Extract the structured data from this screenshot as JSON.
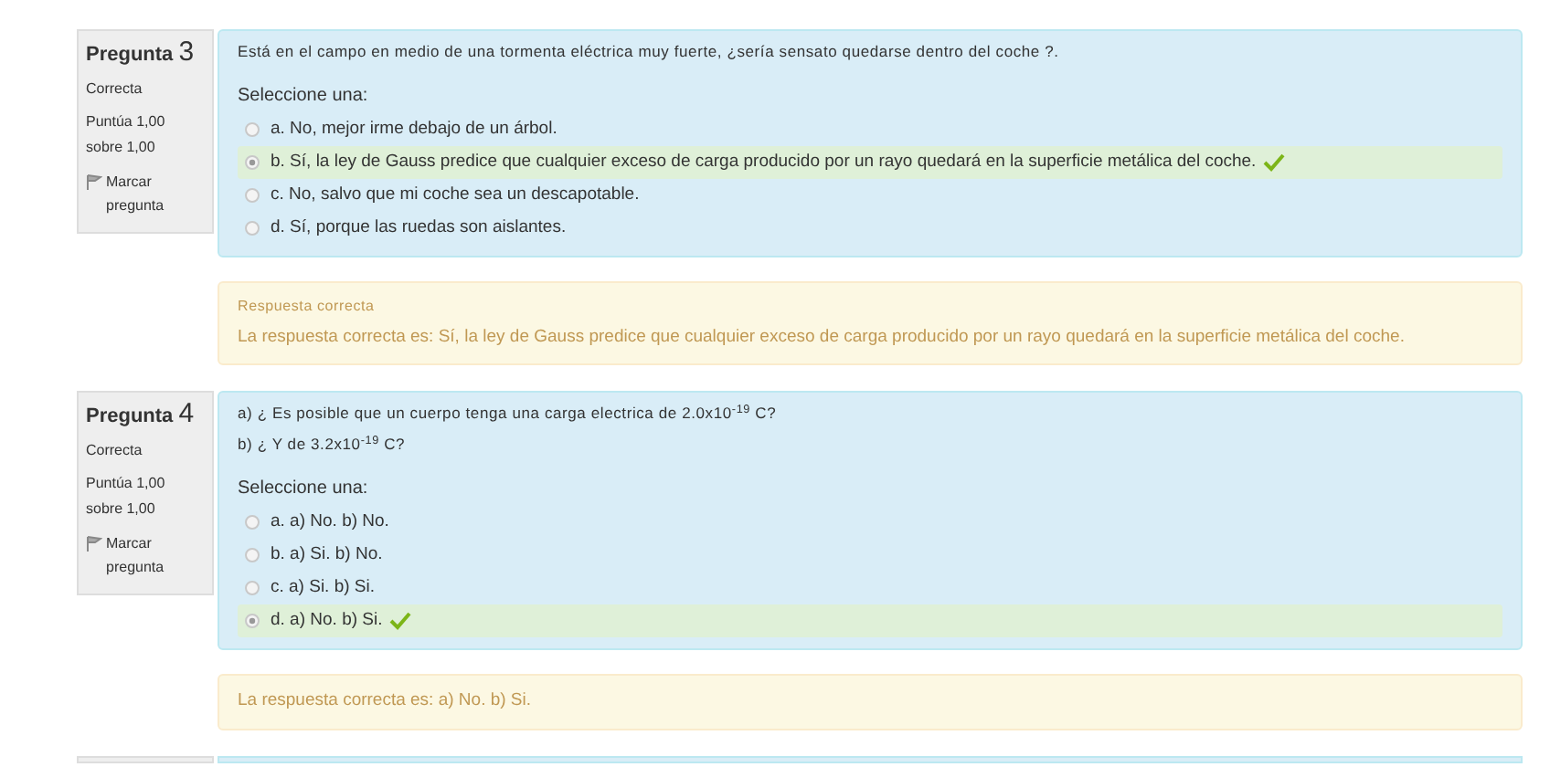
{
  "questions": [
    {
      "label": "Pregunta",
      "number": "3",
      "state": "Correcta",
      "score": [
        "Puntúa 1,00",
        "sobre 1,00"
      ],
      "flag": "Marcar pregunta",
      "question_lines": [
        "Está en el campo en medio de una tormenta eléctrica muy fuerte, ¿sería sensato quedarse dentro del coche ?."
      ],
      "prompt": "Seleccione una:",
      "options": [
        {
          "text": "a. No, mejor irme debajo de un árbol.",
          "selected": false,
          "correct": false
        },
        {
          "text": "b. Sí, la ley de Gauss predice que cualquier exceso de carga producido por un rayo quedará en la superficie metálica del coche.",
          "selected": true,
          "correct": true
        },
        {
          "text": "c. No, salvo que mi coche sea un descapotable.",
          "selected": false,
          "correct": false
        },
        {
          "text": "d. Sí, porque las ruedas son aislantes.",
          "selected": false,
          "correct": false
        }
      ],
      "feedback": {
        "title": "Respuesta correcta",
        "text": "La respuesta correcta es: Sí, la ley de Gauss predice que cualquier exceso de carga producido por un rayo quedará en la superficie metálica del coche."
      }
    },
    {
      "label": "Pregunta",
      "number": "4",
      "state": "Correcta",
      "score": [
        "Puntúa 1,00",
        "sobre 1,00"
      ],
      "flag": "Marcar pregunta",
      "question_lines": [
        "a) ¿ Es posible que un cuerpo tenga una carga electrica de 2.0x10$^{-19}$ C?",
        "b) ¿ Y de 3.2x10$^{-19}$ C?"
      ],
      "prompt": "Seleccione una:",
      "options": [
        {
          "text": "a. a) No. b) No.",
          "selected": false,
          "correct": false
        },
        {
          "text": "b. a) Si. b) No.",
          "selected": false,
          "correct": false
        },
        {
          "text": "c. a) Si. b) Si.",
          "selected": false,
          "correct": false
        },
        {
          "text": "d. a) No. b) Si.",
          "selected": true,
          "correct": true
        }
      ],
      "feedback": {
        "text": "La respuesta correcta es: a) No. b) Si."
      }
    }
  ]
}
